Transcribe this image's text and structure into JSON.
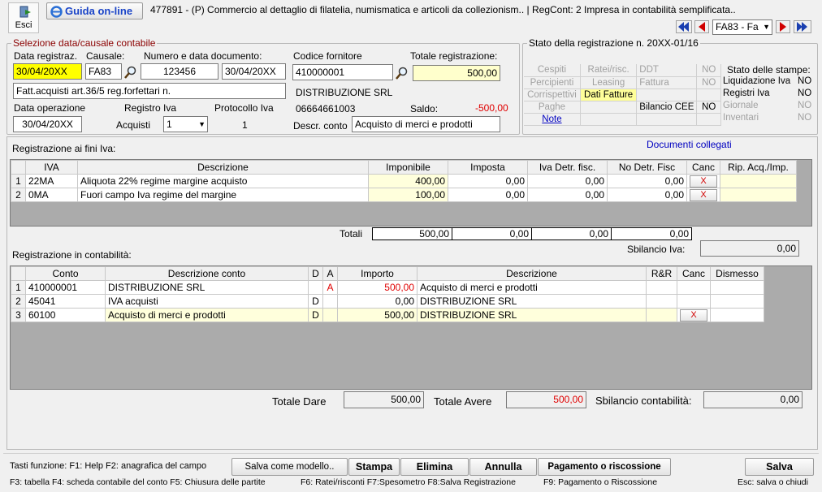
{
  "toolbar": {
    "esci_label": "Esci",
    "guida_label": "Guida on-line",
    "title": "477891 - (P) Commercio al dettaglio di filatelia, numismatica e articoli da collezionism.. | RegCont: 2 Impresa  in contabilità semplificata..",
    "causale_nav": "FA83 - Fa"
  },
  "sel": {
    "title": "Selezione data/causale contabile",
    "data_reg_label": "Data registraz.",
    "data_reg": "30/04/20XX",
    "causale_label": "Causale:",
    "causale": "FA83",
    "numdoc_label": "Numero e data documento:",
    "numdoc": "123456",
    "datadoc": "30/04/20XX",
    "causale_desc": "Fatt.acquisti art.36/5 reg.forfettari n.",
    "data_op_label": "Data operazione",
    "data_op": "30/04/20XX",
    "registro_label": "Registro Iva",
    "registro_type": "Acquisti",
    "registro_val": "1",
    "protocollo_label": "Protocollo Iva",
    "protocollo_val": "1",
    "fornitore_label": "Codice fornitore",
    "fornitore": "410000001",
    "totale_label": "Totale registrazione:",
    "totale": "500,00",
    "fornitore_name": "DISTRIBUZIONE SRL",
    "phone": "06664661003",
    "saldo_label": "Saldo:",
    "saldo": "-500,00",
    "descr_conto_label": "Descr. conto",
    "descr_conto": "Acquisto di merci e prodotti"
  },
  "stato": {
    "title": "Stato della registrazione n. 20XX-01/16",
    "cells": {
      "cespiti": "Cespiti",
      "ratei": "Ratei/risc.",
      "ddt": "DDT",
      "no1": "NO",
      "percipienti": "Percipienti",
      "leasing": "Leasing",
      "fattura": "Fattura",
      "no2": "NO",
      "corrispettivi": "Corrispettivi",
      "dati_fatture": "Dati Fatture",
      "paghe": "Paghe",
      "bilancio": "Bilancio CEE",
      "no3": "NO",
      "note": "Note"
    },
    "stampe_title": "Stato delle stampe:",
    "stampe": [
      {
        "label": "Liquidazione Iva",
        "val": "NO"
      },
      {
        "label": "Registri Iva",
        "val": "NO"
      },
      {
        "label": "Giornale",
        "val": "NO"
      },
      {
        "label": "Inventari",
        "val": "NO"
      }
    ]
  },
  "iva": {
    "title": "Registrazione ai fini Iva:",
    "link": "Documenti collegati",
    "headers": [
      "IVA",
      "Descrizione",
      "Imponibile",
      "Imposta",
      "Iva Detr. fisc.",
      "No Detr. Fisc",
      "Canc",
      "Rip. Acq./Imp."
    ],
    "rows": [
      {
        "n": "1",
        "iva": "22MA",
        "desc": "Aliquota 22% regime margine acquisto",
        "imp": "400,00",
        "imposta": "0,00",
        "detr": "0,00",
        "nodetr": "0,00",
        "canc": "X"
      },
      {
        "n": "2",
        "iva": "0MA",
        "desc": "Fuori campo Iva regime del margine",
        "imp": "100,00",
        "imposta": "0,00",
        "detr": "0,00",
        "nodetr": "0,00",
        "canc": "X"
      }
    ],
    "totali_label": "Totali",
    "totali": [
      "500,00",
      "0,00",
      "0,00",
      "0,00"
    ],
    "sbil_label": "Sbilancio Iva:",
    "sbil": "0,00"
  },
  "cont": {
    "title": "Registrazione in contabilità:",
    "headers": [
      "Conto",
      "Descrizione conto",
      "D",
      "A",
      "Importo",
      "Descrizione",
      "R&R",
      "Canc",
      "Dismesso"
    ],
    "rows": [
      {
        "n": "1",
        "conto": "410000001",
        "desc": "DISTRIBUZIONE SRL",
        "d": "",
        "a": "A",
        "imp": "500,00",
        "descr": "Acquisto di merci e prodotti",
        "canc": ""
      },
      {
        "n": "2",
        "conto": "45041",
        "desc": "IVA acquisti",
        "d": "D",
        "a": "",
        "imp": "0,00",
        "descr": "DISTRIBUZIONE SRL",
        "canc": ""
      },
      {
        "n": "3",
        "conto": "60100",
        "desc": "Acquisto di merci e prodotti",
        "d": "D",
        "a": "",
        "imp": "500,00",
        "descr": "DISTRIBUZIONE SRL",
        "canc": "X"
      }
    ],
    "dare_label": "Totale Dare",
    "dare": "500,00",
    "avere_label": "Totale Avere",
    "avere": "500,00",
    "sbil_label": "Sbilancio contabilità:",
    "sbil": "0,00"
  },
  "footer": {
    "tasti": "Tasti funzione: F1: Help  F2: anagrafica del campo",
    "salva_modello": "Salva come modello..",
    "stampa": "Stampa",
    "elimina": "Elimina",
    "annulla": "Annulla",
    "pagamento": "Pagamento o riscossione",
    "salva": "Salva",
    "keys2": "F3: tabella   F4: scheda contabile del conto   F5: Chiusura delle partite",
    "keys3": "F6: Ratei/risconti   F7:Spesometro   F8:Salva Registrazione",
    "keys4": "F9: Pagamento o Riscossione",
    "esc": "Esc: salva o chiudi"
  },
  "colors": {
    "accent_blue": "#1a44c8",
    "red": "#e00000",
    "yellow": "#ffff00",
    "light_yellow": "#ffffcc"
  }
}
